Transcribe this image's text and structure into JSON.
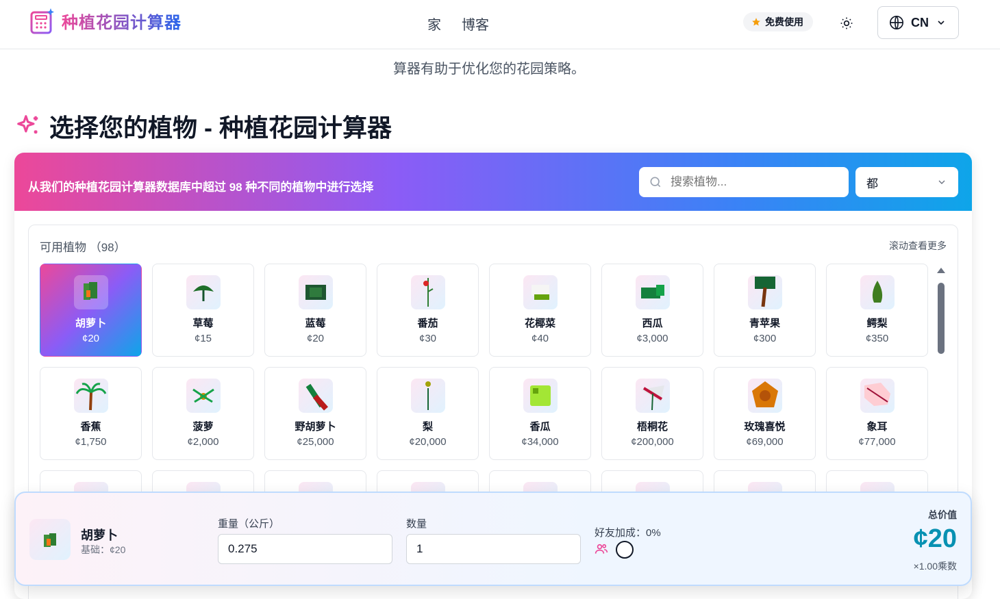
{
  "header": {
    "logo_text": "种植花园计算器",
    "nav": [
      {
        "label": "家"
      },
      {
        "label": "博客"
      }
    ],
    "free_badge": "免费使用",
    "lang": "CN"
  },
  "intro": {
    "line2": "算器有助于优化您的花园策略。"
  },
  "section": {
    "title": "选择您的植物 - 种植花园计算器"
  },
  "banner": {
    "text": "从我们的种植花园计算器数据库中超过 98 种不同的植物中进行选择",
    "search_placeholder": "搜索植物...",
    "filter_value": "都"
  },
  "plants": {
    "heading": "可用植物 （98）",
    "scroll_hint": "滚动查看更多",
    "items": [
      {
        "name": "胡萝卜",
        "price": "¢20"
      },
      {
        "name": "草莓",
        "price": "¢15"
      },
      {
        "name": "蓝莓",
        "price": "¢20"
      },
      {
        "name": "番茄",
        "price": "¢30"
      },
      {
        "name": "花椰菜",
        "price": "¢40"
      },
      {
        "name": "西瓜",
        "price": "¢3,000"
      },
      {
        "name": "青苹果",
        "price": "¢300"
      },
      {
        "name": "鳄梨",
        "price": "¢350"
      },
      {
        "name": "香蕉",
        "price": "¢1,750"
      },
      {
        "name": "菠萝",
        "price": "¢2,000"
      },
      {
        "name": "野胡萝卜",
        "price": "¢25,000"
      },
      {
        "name": "梨",
        "price": "¢20,000"
      },
      {
        "name": "香瓜",
        "price": "¢34,000"
      },
      {
        "name": "梧桐花",
        "price": "¢200,000"
      },
      {
        "name": "玫瑰喜悦",
        "price": "¢69,000"
      },
      {
        "name": "象耳",
        "price": "¢77,000"
      }
    ]
  },
  "calc": {
    "plant_name": "胡萝卜",
    "base": "基础：¢20",
    "weight_label": "重量（公斤）",
    "weight_value": "0.275",
    "qty_label": "数量",
    "qty_value": "1",
    "friend_label": "好友加成：0%",
    "total_label": "总价值",
    "total_value": "¢20",
    "multiplier": "×1.00乘数"
  },
  "colors": {
    "accent_pink": "#ec4899",
    "accent_blue": "#0ea5e9",
    "total_teal": "#0891b2"
  }
}
